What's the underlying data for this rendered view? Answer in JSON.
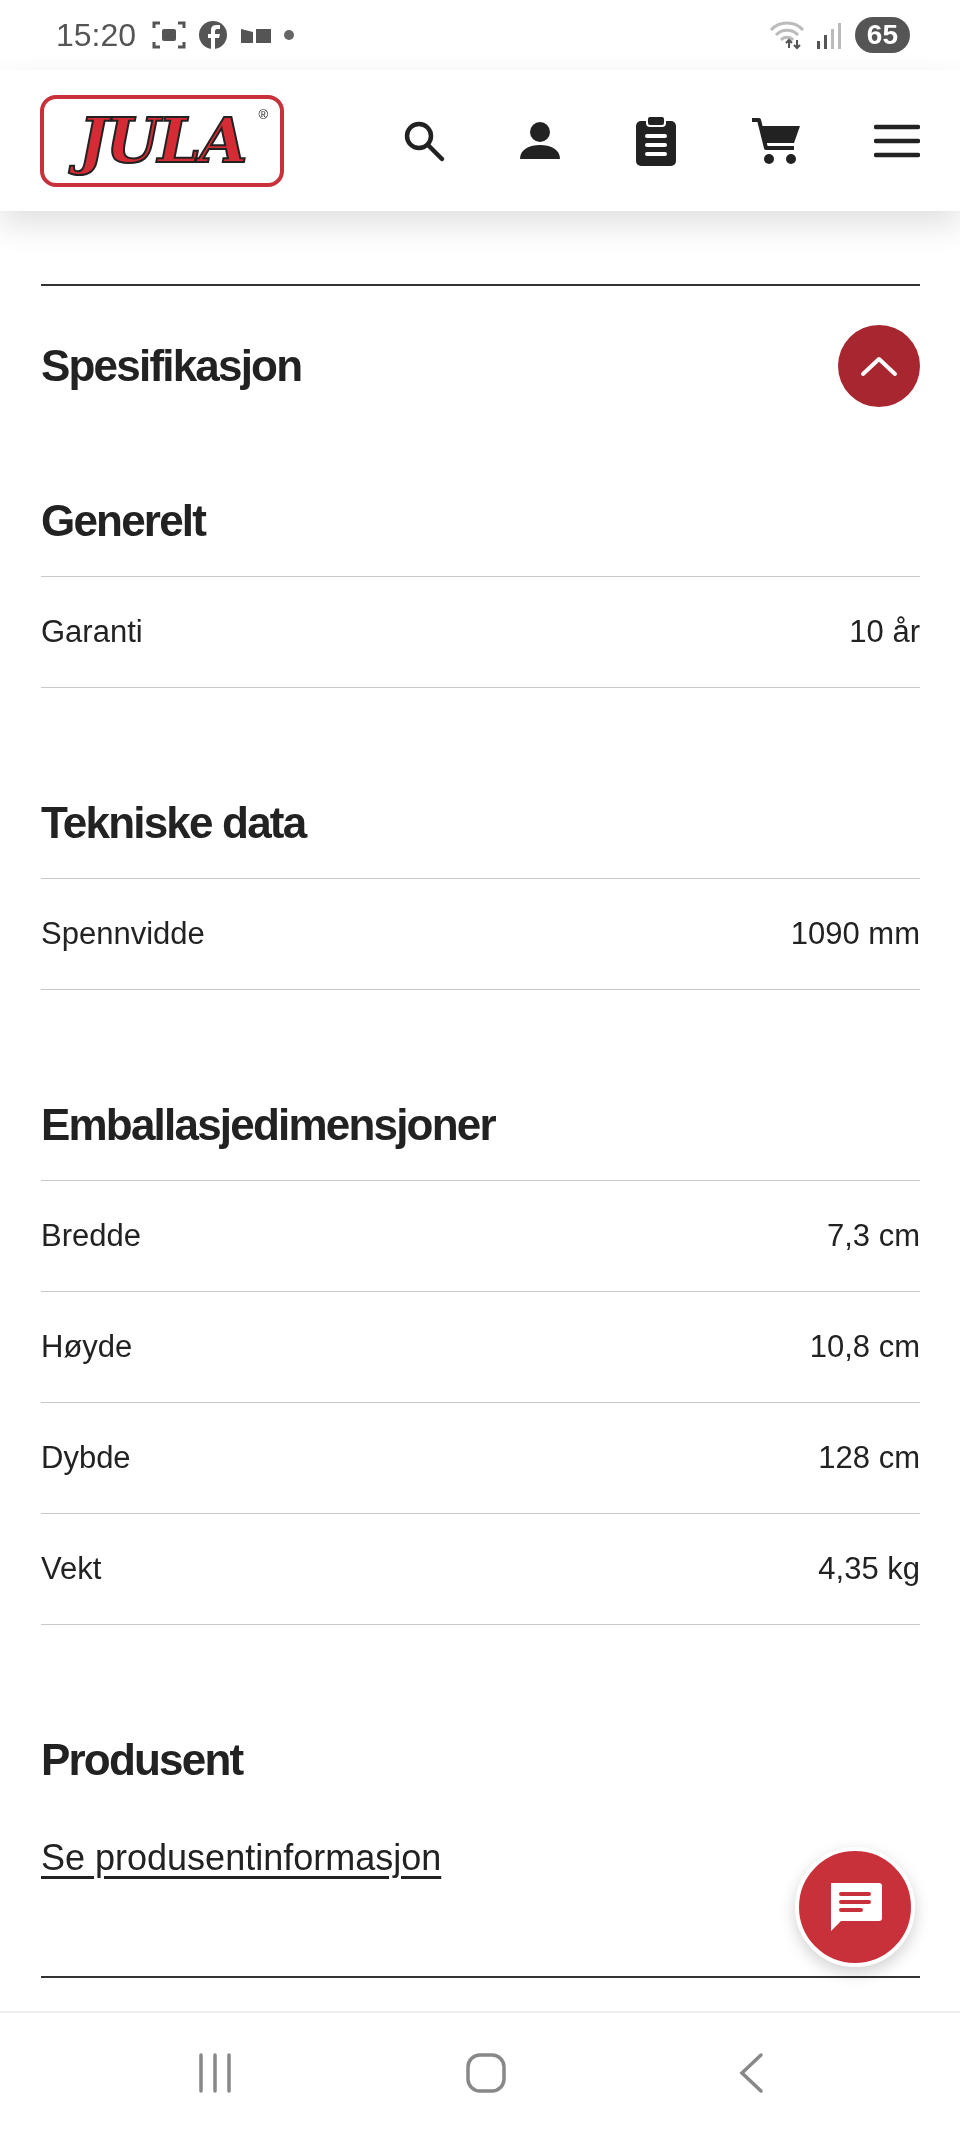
{
  "status_bar": {
    "time": "15:20",
    "battery": "65"
  },
  "header": {
    "logo": "JULA",
    "logo_mark": "®"
  },
  "specification": {
    "title": "Spesifikasjon",
    "expanded": true,
    "groups": [
      {
        "title": "Generelt",
        "rows": [
          {
            "label": "Garanti",
            "value": "10 år"
          }
        ]
      },
      {
        "title": "Tekniske data",
        "rows": [
          {
            "label": "Spennvidde",
            "value": "1090 mm"
          }
        ]
      },
      {
        "title": "Emballasjedimensjoner",
        "rows": [
          {
            "label": "Bredde",
            "value": "7,3 cm"
          },
          {
            "label": "Høyde",
            "value": "10,8 cm"
          },
          {
            "label": "Dybde",
            "value": "128 cm"
          },
          {
            "label": "Vekt",
            "value": "4,35 kg"
          }
        ]
      }
    ]
  },
  "manufacturer": {
    "title": "Produsent",
    "link": "Se produsentinformasjon"
  }
}
